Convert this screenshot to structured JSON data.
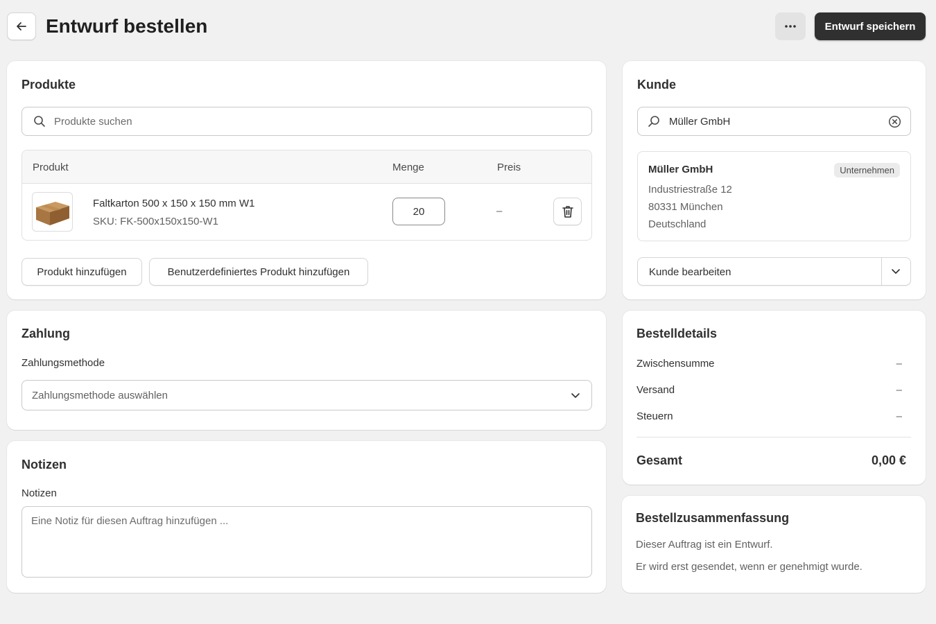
{
  "header": {
    "title": "Entwurf bestellen",
    "save_label": "Entwurf speichern"
  },
  "products": {
    "title": "Produkte",
    "search_placeholder": "Produkte suchen",
    "columns": {
      "product": "Produkt",
      "quantity": "Menge",
      "price": "Preis"
    },
    "items": [
      {
        "name": "Faltkarton 500 x 150 x 150 mm W1",
        "sku": "SKU: FK-500x150x150-W1",
        "quantity": "20",
        "price": "–"
      }
    ],
    "add_product_label": "Produkt hinzufügen",
    "add_custom_label": "Benutzerdefiniertes Produkt hinzufügen"
  },
  "customer": {
    "title": "Kunde",
    "search_value": "Müller GmbH",
    "name": "Müller GmbH",
    "badge": "Unternehmen",
    "address_line1": "Industriestraße 12",
    "address_line2": "80331 München",
    "address_line3": "Deutschland",
    "edit_label": "Kunde bearbeiten"
  },
  "payment": {
    "title": "Zahlung",
    "method_label": "Zahlungsmethode",
    "method_placeholder": "Zahlungsmethode auswählen"
  },
  "notes": {
    "title": "Notizen",
    "field_label": "Notizen",
    "placeholder": "Eine Notiz für diesen Auftrag hinzufügen ..."
  },
  "order_details": {
    "title": "Bestelldetails",
    "subtotal_label": "Zwischensumme",
    "subtotal_value": "–",
    "shipping_label": "Versand",
    "shipping_value": "–",
    "taxes_label": "Steuern",
    "taxes_value": "–",
    "total_label": "Gesamt",
    "total_value": "0,00 €"
  },
  "summary": {
    "title": "Bestellzusammenfassung",
    "line1": "Dieser Auftrag ist ein Entwurf.",
    "line2": "Er wird erst gesendet, wenn er genehmigt wurde."
  },
  "colors": {
    "background": "#f1f1f1",
    "primary_button": "#303030",
    "badge_bg": "#ebebeb"
  }
}
